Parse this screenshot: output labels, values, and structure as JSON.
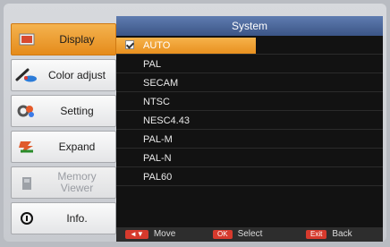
{
  "menu": {
    "items": [
      {
        "label": "Display",
        "icon": "display-icon",
        "state": "selected"
      },
      {
        "label": "Color adjust",
        "icon": "color-adjust-icon",
        "state": "normal"
      },
      {
        "label": "Setting",
        "icon": "setting-icon",
        "state": "normal"
      },
      {
        "label": "Expand",
        "icon": "expand-icon",
        "state": "normal"
      },
      {
        "label": "Memory\nViewer",
        "icon": "memory-viewer-icon",
        "state": "disabled"
      },
      {
        "label": "Info.",
        "icon": "info-icon",
        "state": "normal"
      }
    ]
  },
  "panel": {
    "title": "System",
    "options": [
      {
        "label": "AUTO",
        "selected": true,
        "checked": true
      },
      {
        "label": "PAL"
      },
      {
        "label": "SECAM"
      },
      {
        "label": "NTSC"
      },
      {
        "label": "NESC4.43"
      },
      {
        "label": "PAL-M"
      },
      {
        "label": "PAL-N"
      },
      {
        "label": "PAL60"
      }
    ]
  },
  "footer": {
    "move_key": "◄▼",
    "move_label": "Move",
    "select_key": "OK",
    "select_label": "Select",
    "back_key": "Exit",
    "back_label": "Back"
  },
  "colors": {
    "accent": "#E8901F",
    "title": "#4A6699",
    "background": "#121212"
  }
}
